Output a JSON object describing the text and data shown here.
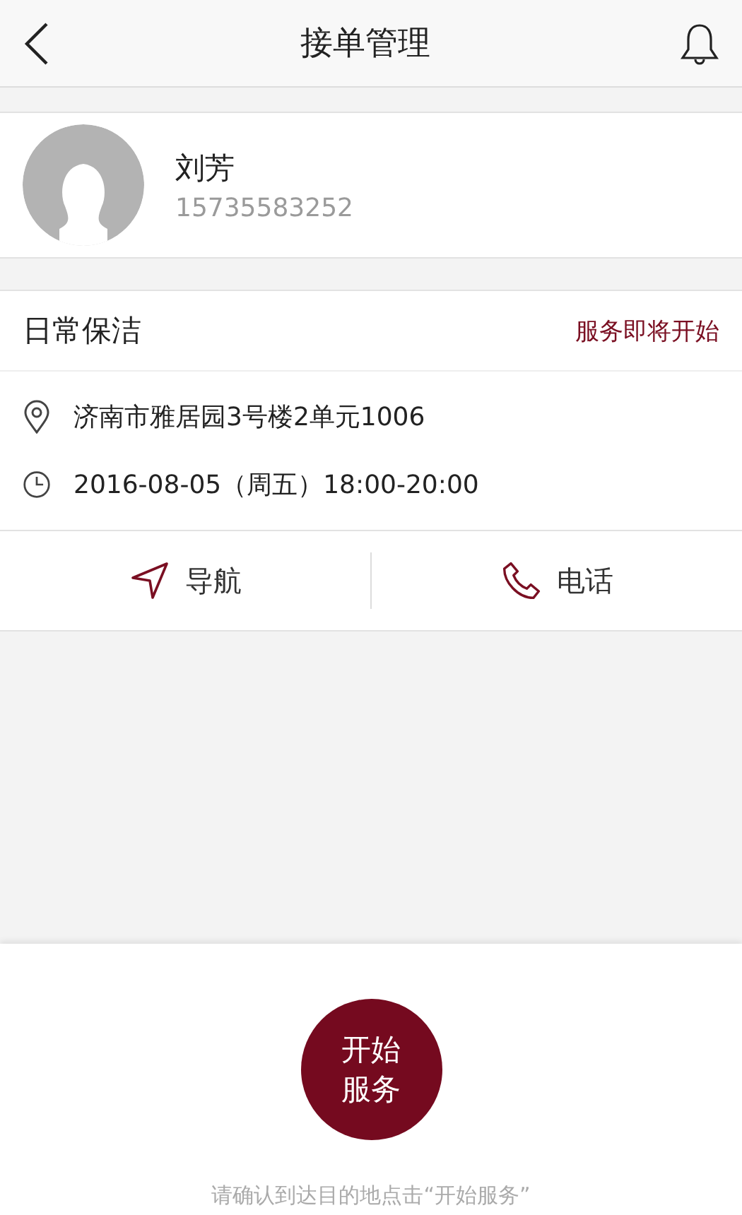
{
  "header": {
    "title": "接单管理"
  },
  "customer": {
    "name": "刘芳",
    "phone": "15735583252"
  },
  "order": {
    "service": "日常保洁",
    "status": "服务即将开始",
    "details": [
      {
        "kind": "address",
        "text": "济南市雅居园3号楼2单元1006"
      },
      {
        "kind": "time",
        "text": "2016-08-05（周五）18:00-20:00"
      }
    ]
  },
  "actions": [
    {
      "kind": "navigate",
      "label": "导航"
    },
    {
      "kind": "phone",
      "label": "电话"
    }
  ],
  "start": {
    "label_lines": [
      "开始",
      "服务"
    ],
    "hint": "请确认到达目的地点击“开始服务”"
  }
}
